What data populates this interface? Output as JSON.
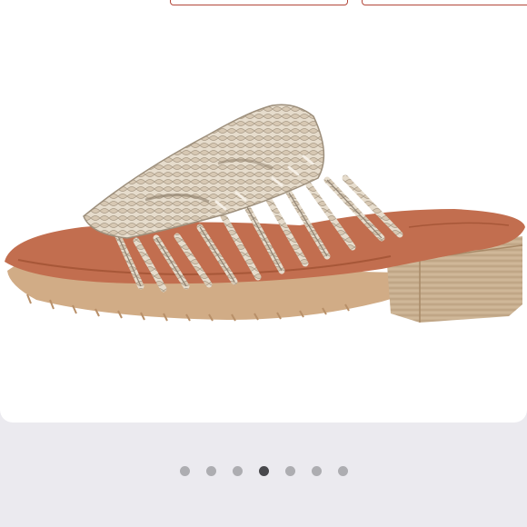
{
  "carousel": {
    "slide_count": 7,
    "active_index": 3,
    "colors": {
      "dot_inactive": "#adadb1",
      "dot_active": "#48484c"
    }
  },
  "image": {
    "icon": "sandal-product-photo"
  },
  "actions": {
    "button_border_color": "#b3473a"
  }
}
